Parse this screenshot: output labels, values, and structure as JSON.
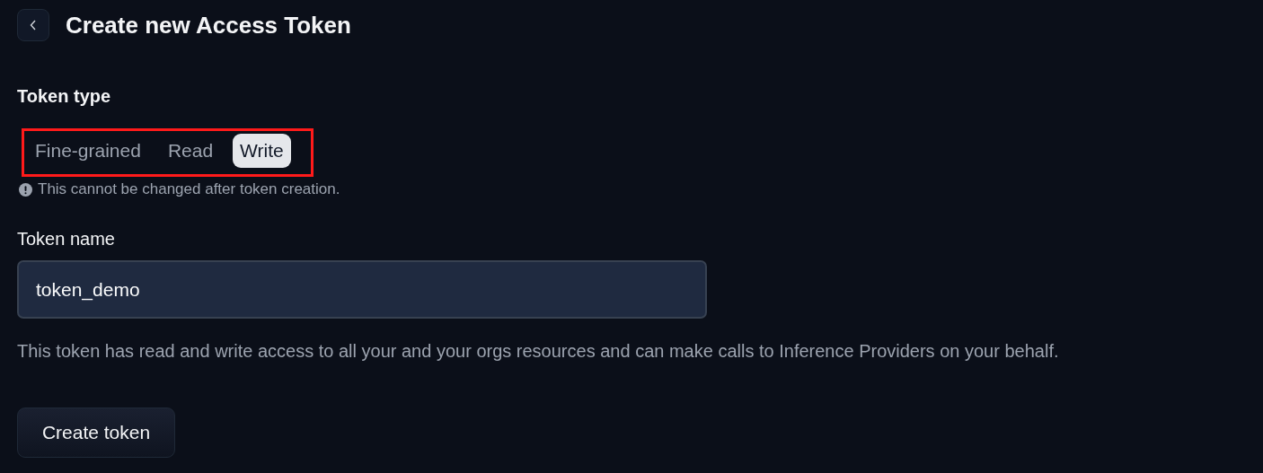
{
  "header": {
    "title": "Create new Access Token"
  },
  "token_type": {
    "label": "Token type",
    "highlighted": true,
    "options": [
      {
        "label": "Fine-grained",
        "selected": false
      },
      {
        "label": "Read",
        "selected": false
      },
      {
        "label": "Write",
        "selected": true
      }
    ],
    "note": "This cannot be changed after token creation."
  },
  "token_name": {
    "label": "Token name",
    "value": "token_demo"
  },
  "description": "This token has read and write access to all your and your orgs resources and can make calls to Inference Providers on your behalf.",
  "buttons": [
    "Create token"
  ]
}
